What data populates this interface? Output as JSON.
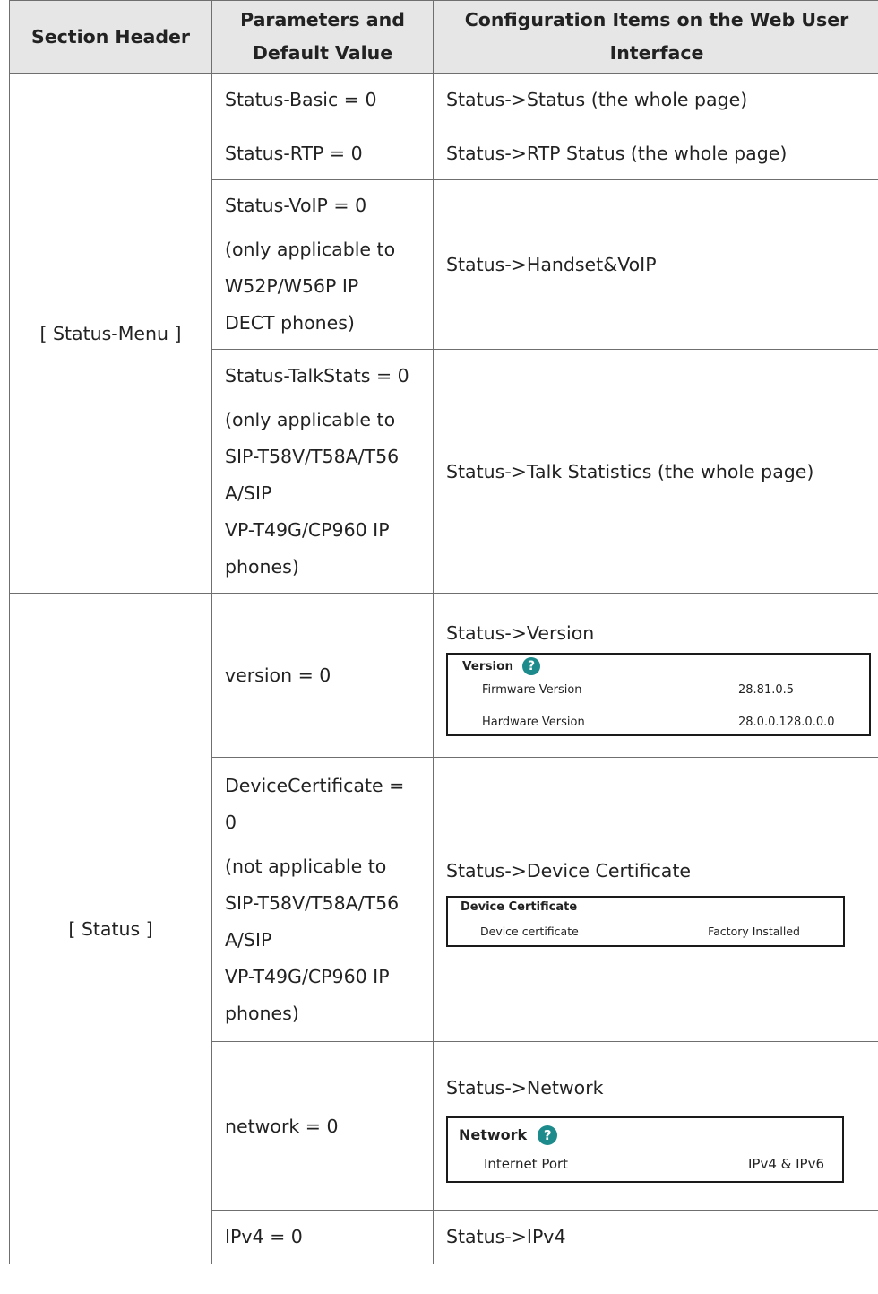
{
  "headers": {
    "col1": "Section Header",
    "col2_line1": "Parameters and",
    "col2_line2": "Default Value",
    "col3_line1": "Configuration Items on the Web User",
    "col3_line2": "Interface"
  },
  "sections": [
    {
      "name": "[ Status-Menu ]"
    },
    {
      "name": "[ Status ]"
    }
  ],
  "rows": {
    "status_basic": {
      "param": "Status-Basic = 0",
      "config": "Status->Status (the whole page)"
    },
    "status_rtp": {
      "param": "Status-RTP = 0",
      "config": "Status->RTP Status (the whole page)"
    },
    "status_voip": {
      "param": "Status-VoIP = 0",
      "note": [
        "(only applicable to",
        "W52P/W56P IP",
        "DECT phones)"
      ],
      "config": "Status->Handset&VoIP"
    },
    "status_talkstats": {
      "param": "Status-TalkStats = 0",
      "note": [
        "(only applicable to",
        "SIP-T58V/T58A/T56",
        "A/SIP",
        "VP-T49G/CP960 IP",
        "phones)"
      ],
      "config": "Status->Talk Statistics (the whole page)"
    },
    "version": {
      "param": "version = 0",
      "config": "Status->Version",
      "panel": {
        "title": "Version",
        "items": [
          {
            "label": "Firmware Version",
            "value": "28.81.0.5"
          },
          {
            "label": "Hardware Version",
            "value": "28.0.0.128.0.0.0"
          }
        ]
      }
    },
    "device_certificate": {
      "param_line1": "DeviceCertificate =",
      "param_line2": "0",
      "note": [
        "(not applicable to",
        "SIP-T58V/T58A/T56",
        "A/SIP",
        "VP-T49G/CP960 IP",
        "phones)"
      ],
      "config": "Status->Device Certificate",
      "panel": {
        "title": "Device Certificate",
        "items": [
          {
            "label": "Device certificate",
            "value": "Factory Installed"
          }
        ]
      }
    },
    "network": {
      "param": "network = 0",
      "config": "Status->Network",
      "panel": {
        "title": "Network",
        "items": [
          {
            "label": "Internet Port",
            "value": "IPv4 & IPv6"
          }
        ]
      }
    },
    "ipv4": {
      "param": "IPv4 = 0",
      "config": "Status->IPv4"
    }
  },
  "icons": {
    "help": "help-circle-icon",
    "help_color": "#1d8b8b"
  }
}
